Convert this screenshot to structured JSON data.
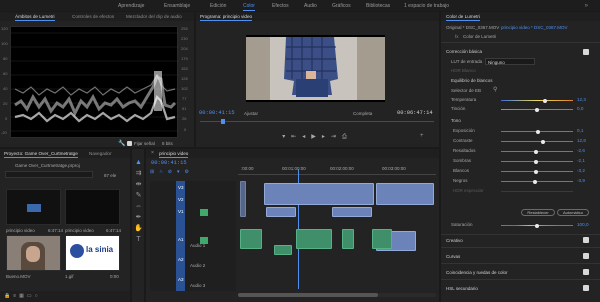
{
  "workspaces": [
    "Aprendizaje",
    "Ensamblaje",
    "Edición",
    "Color",
    "Efectos",
    "Audio",
    "Gráficos",
    "Bibliotecas",
    "1 espacio de trabajo"
  ],
  "active_workspace": "Color",
  "scopes_panel": {
    "tabs": [
      "Ámbitos de Lumetri",
      "Controles de efectos",
      "Mezclador del clip de audio"
    ],
    "left_scale": [
      "120",
      "100",
      "80",
      "60",
      "40",
      "20",
      "0",
      "-20"
    ],
    "right_scale": [
      "255",
      "230",
      "204",
      "179",
      "153",
      "128",
      "102",
      "77",
      "51",
      "26",
      "0"
    ],
    "clamp_label": "Fijar señal",
    "bits_value": "8 bits"
  },
  "program_monitor": {
    "title": "Programa: principio video",
    "timecode": "00:00:41:15",
    "fit_label": "Ajustar",
    "quality_label": "Completa",
    "duration": "00:06:47:14"
  },
  "project_panel": {
    "title": "Proyecto: Game Over_Curtmetratge",
    "tab_navegador": "Navegador",
    "file_name": "Game Over_Curtmetratge.prproj",
    "count": "87 ele",
    "items": [
      {
        "name": "principio video",
        "duration": "6:47:14"
      },
      {
        "name": "principio video",
        "duration": "6:47:14"
      },
      {
        "name": "Bueno.MOV",
        "duration": ""
      },
      {
        "name": "1.gif",
        "duration": "0:00"
      }
    ],
    "logo_text": "la sinia"
  },
  "timeline": {
    "title": "principio video",
    "timecode": "00:00:41:15",
    "ruler": [
      ":00:00",
      "00:01:00:00",
      "00:02:00:00",
      "00:03:00:00"
    ],
    "tracks": [
      {
        "id": "V3",
        "name": ""
      },
      {
        "id": "V2",
        "name": ""
      },
      {
        "id": "V1",
        "name": ""
      },
      {
        "id": "A1",
        "name": "Audio 1"
      },
      {
        "id": "A2",
        "name": "Audio 2"
      },
      {
        "id": "A3",
        "name": "Audio 3"
      }
    ]
  },
  "lumetri": {
    "header": "Color de Lumetri",
    "master_label": "Original * DSC_0367.MOV",
    "clip_label": "principio video * DSC_0367.MOV",
    "fx_label": "Color de Lumetri",
    "fx_prefix": "fx",
    "section_basic": "Corrección básica",
    "lut_label": "LUT de entrada",
    "lut_value": "Ninguno",
    "hdr_label": "HDR Blanco",
    "wb_section": "Equilibrio de blancos",
    "wb_selector": "Selector de EB",
    "temperature": {
      "label": "Temperatura",
      "value": "12,3"
    },
    "tint": {
      "label": "Tinción",
      "value": "0,0"
    },
    "tone_section": "Tono",
    "tone_rows": [
      {
        "label": "Exposición",
        "value": "0,1"
      },
      {
        "label": "Contraste",
        "value": "12,6"
      },
      {
        "label": "Resaltados",
        "value": "-2,6"
      },
      {
        "label": "Sombras",
        "value": "-2,1"
      },
      {
        "label": "Blancos",
        "value": "-3,2"
      },
      {
        "label": "Negros",
        "value": "-3,9"
      },
      {
        "label": "HDR especular",
        "value": ""
      }
    ],
    "btn_restore": "Restablecer",
    "btn_auto": "Automático",
    "saturation": {
      "label": "Saturación",
      "value": "100,0"
    },
    "sections": [
      "Creativo",
      "Curvas",
      "Coincidencia y ruedas de color",
      "HSL secundario"
    ]
  },
  "colors": {
    "accent": "#4f8ff0",
    "panel": "#232323",
    "bg": "#1a1a1a",
    "video_clip": "#6b83b8",
    "audio_clip": "#3f8f6a"
  }
}
